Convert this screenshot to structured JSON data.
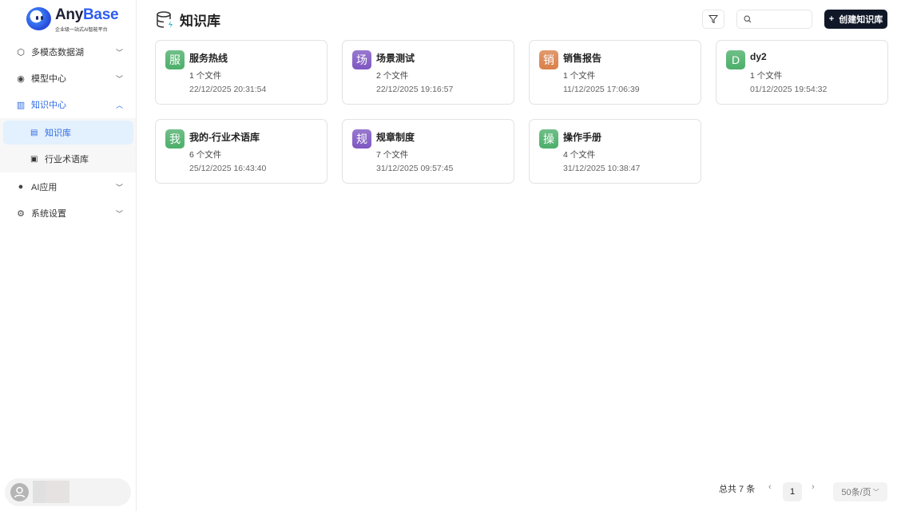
{
  "brand": {
    "name_a": "Any",
    "name_b": "Base",
    "tagline": "企业级一站式AI智能平台"
  },
  "sidebar": {
    "items": [
      {
        "label": "多模态数据湖",
        "icon": "cube-icon"
      },
      {
        "label": "模型中心",
        "icon": "model-icon"
      },
      {
        "label": "知识中心",
        "icon": "books-icon",
        "active": true
      },
      {
        "label": "AI应用",
        "icon": "ai-app-icon"
      },
      {
        "label": "系统设置",
        "icon": "gear-icon"
      }
    ],
    "sub_items": [
      {
        "label": "知识库",
        "selected": true
      },
      {
        "label": "行业术语库"
      }
    ]
  },
  "header": {
    "title": "知识库",
    "create_label": "创建知识库",
    "search_placeholder": ""
  },
  "cards": [
    {
      "avatar": "服",
      "name": "服务热线",
      "files": "1 个文件",
      "date": "22/12/2025 20:31:54",
      "color": "#4caf6a"
    },
    {
      "avatar": "场",
      "name": "场景测试",
      "files": "2 个文件",
      "date": "22/12/2025 19:16:57",
      "color": "#7e57c2"
    },
    {
      "avatar": "销",
      "name": "销售报告",
      "files": "1 个文件",
      "date": "11/12/2025 17:06:39",
      "color": "#d9804a"
    },
    {
      "avatar": "D",
      "name": "dy2",
      "files": "1 个文件",
      "date": "01/12/2025 19:54:32",
      "color": "#4caf6a"
    },
    {
      "avatar": "我",
      "name": "我的-行业术语库",
      "files": "6 个文件",
      "date": "25/12/2025 16:43:40",
      "color": "#4caf6a"
    },
    {
      "avatar": "规",
      "name": "规章制度",
      "files": "7 个文件",
      "date": "31/12/2025 09:57:45",
      "color": "#7e57c2"
    },
    {
      "avatar": "操",
      "name": "操作手册",
      "files": "4 个文件",
      "date": "31/12/2025 10:38:47",
      "color": "#4caf6a"
    }
  ],
  "pagination": {
    "total": "总共 7 条",
    "page": "1",
    "page_size": "50条/页"
  }
}
